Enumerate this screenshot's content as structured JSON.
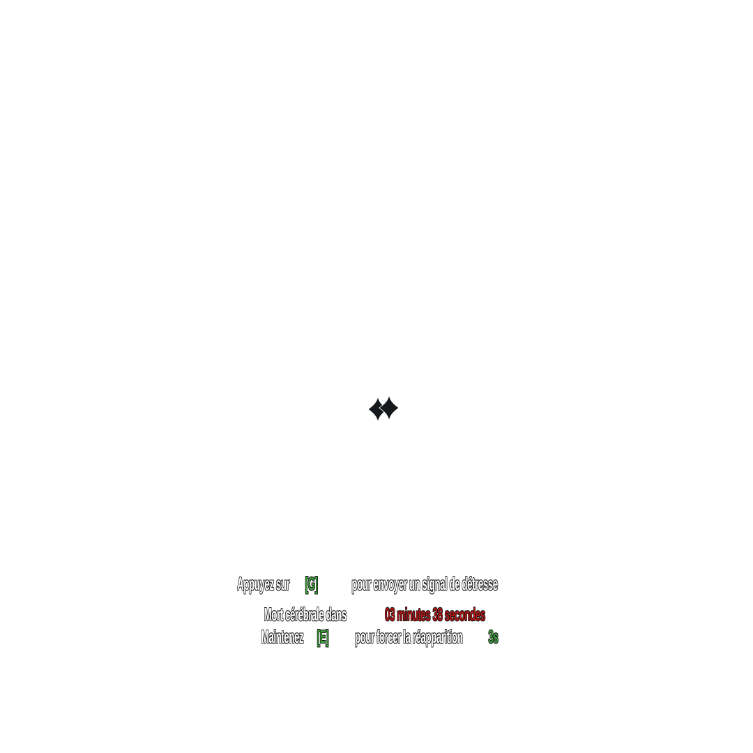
{
  "logo": {
    "icon": "double-diamond-logo-icon",
    "color": "#15181c"
  },
  "distress": {
    "prefix": "Appuyez sur",
    "key": "[G]",
    "suffix": "pour envoyer un signal de détresse"
  },
  "brain_death": {
    "prefix": "Mort cérébrale dans",
    "timer": "03 minutes 38 secondes"
  },
  "respawn": {
    "prefix": "Maintenez",
    "key": "[E]",
    "middle": "pour forcer la réapparition",
    "hold_time": "3s"
  },
  "colors": {
    "text": "#ffffff",
    "outline": "#111111",
    "key": "#3f9d3f",
    "timer": "#b01515"
  }
}
